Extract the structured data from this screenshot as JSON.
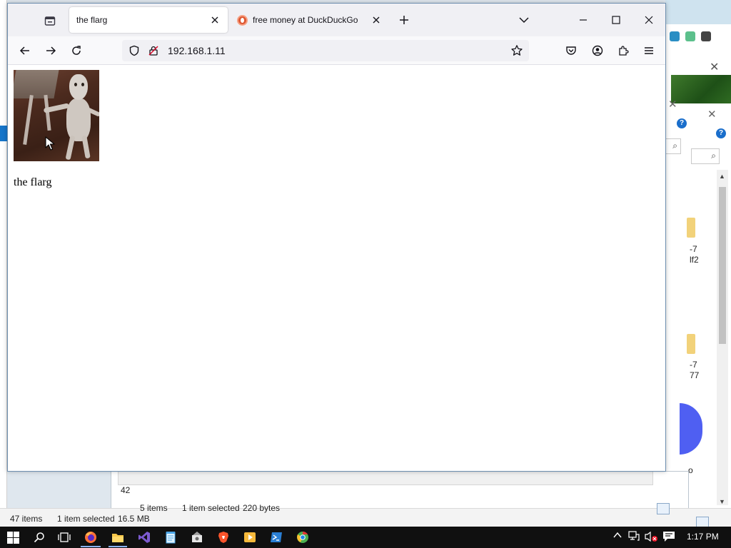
{
  "browser": {
    "tabs": [
      {
        "title": "the flarg",
        "active": true
      },
      {
        "title": "free money at DuckDuckGo",
        "active": false
      }
    ],
    "url": "192.168.1.11",
    "page": {
      "caption": "the flarg"
    }
  },
  "background": {
    "left_status": {
      "items": "47 items",
      "selected": "1 item selected",
      "size": "16.5 MB"
    },
    "mid_status": {
      "items": "5 items",
      "selected": "1 item selected",
      "size": "220 bytes",
      "partial_number": "42"
    },
    "right_labels": [
      "-7",
      "lf2",
      "-7",
      "77",
      "o"
    ]
  },
  "taskbar": {
    "clock": "1:17 PM"
  },
  "colors": {
    "tabbar": "#f0f0f4",
    "navbar": "#f9f9fb",
    "taskbar": "#101010",
    "duckduckgo": "#de5833"
  }
}
